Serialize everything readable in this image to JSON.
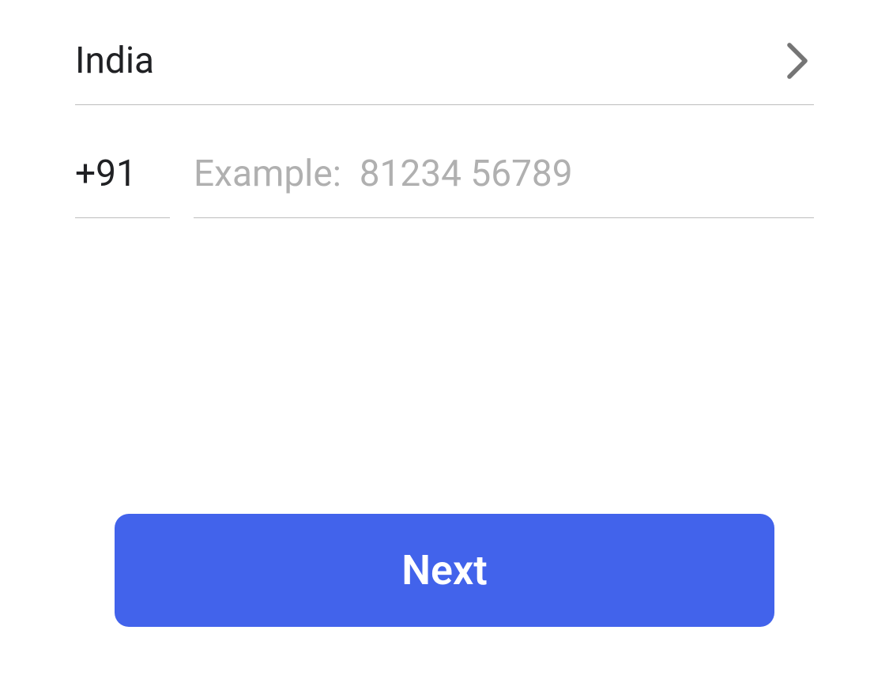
{
  "country": {
    "selected_label": "India"
  },
  "phone": {
    "country_code": "+91",
    "value": "",
    "placeholder": "Example:  81234 56789"
  },
  "buttons": {
    "next_label": "Next"
  },
  "colors": {
    "primary": "#4263eb",
    "text": "#202124",
    "placeholder": "#b0b0b0",
    "divider": "#bdbdbd"
  }
}
